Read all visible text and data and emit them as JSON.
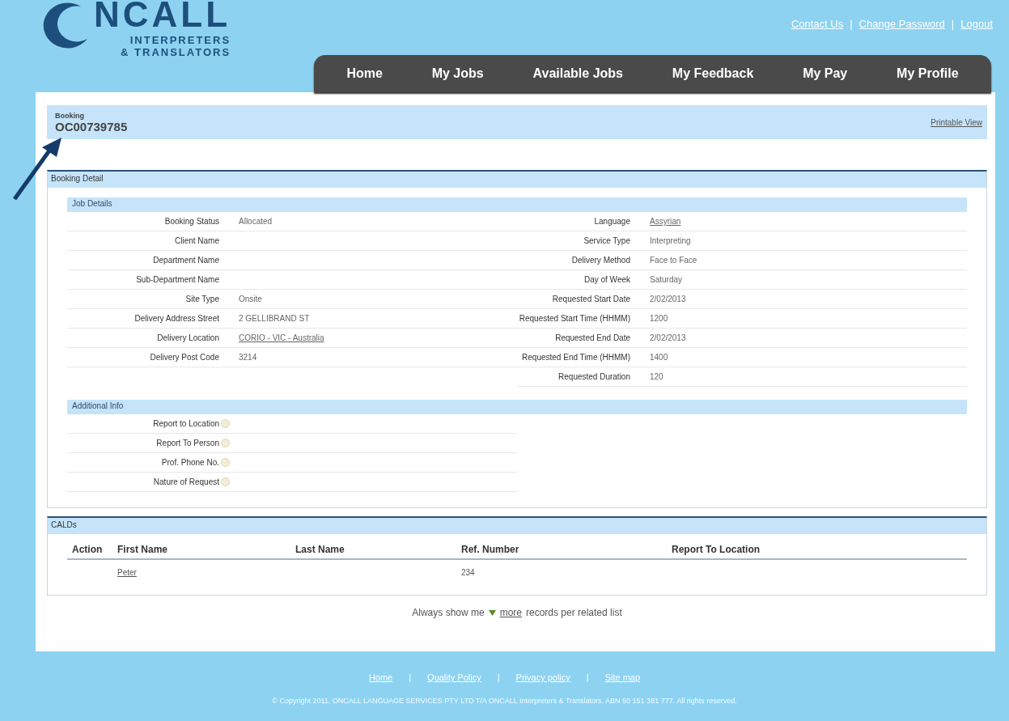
{
  "logo": {
    "name": "NCALL",
    "line_1": "INTERPRETERS",
    "line_2": "& TRANSLATORS"
  },
  "top_links": {
    "items": [
      "Contact Us",
      "Change Password",
      "Logout"
    ],
    "separators": [
      "|",
      "|"
    ]
  },
  "nav": {
    "items": [
      {
        "label": "Home",
        "selected": false
      },
      {
        "label": "My Jobs",
        "selected": false
      },
      {
        "label": "Available Jobs",
        "selected": false
      },
      {
        "label": "My Feedback",
        "selected": false
      },
      {
        "label": "My Pay",
        "selected": false
      },
      {
        "label": "My Profile",
        "selected": false
      }
    ]
  },
  "booking": {
    "label": "Booking",
    "number": "OC00739785",
    "printable_link": "Printable View"
  },
  "booking_detail": {
    "title": "Booking Detail",
    "job_details": {
      "title": "Job Details",
      "left": [
        {
          "label": "Booking Status",
          "value": "Allocated",
          "link": false
        },
        {
          "label": "Client Name"
        },
        {
          "label": "Department Name"
        },
        {
          "label": "Sub-Department Name"
        },
        {
          "label": "Site Type",
          "value": "Onsite",
          "link": false
        },
        {
          "label": "Delivery Address Street",
          "value": "2 GELLIBRAND ST",
          "link": false
        },
        {
          "label": "Delivery Location",
          "value": "CORIO - VIC - Australia",
          "link": true
        },
        {
          "label": "Delivery Post Code",
          "value": "3214",
          "link": false
        }
      ],
      "right": [
        {
          "label": "Language",
          "value": "Assyrian",
          "link": true
        },
        {
          "label": "Service Type",
          "value": "Interpreting",
          "link": false
        },
        {
          "label": "Delivery Method",
          "value": "Face to Face",
          "link": false
        },
        {
          "label": "Day of Week",
          "value": "Saturday",
          "link": false
        },
        {
          "label": "Requested Start Date",
          "value": "2/02/2013",
          "link": false
        },
        {
          "label": "Requested Start Time (HHMM)",
          "value": "1200",
          "link": false
        },
        {
          "label": "Requested End Date",
          "value": "2/02/2013",
          "link": false
        },
        {
          "label": "Requested End Time (HHMM)",
          "value": "1400",
          "link": false
        },
        {
          "label": "Requested Duration",
          "value": "120",
          "link": false
        }
      ]
    },
    "additional_info": {
      "title": "Additional Info",
      "rows": [
        {
          "label": "Report to Location"
        },
        {
          "label": "Report To Person"
        },
        {
          "label": "Prof. Phone No."
        },
        {
          "label": "Nature of Request"
        }
      ]
    }
  },
  "calds": {
    "title": "CALDs",
    "columns": [
      "Action",
      "First Name",
      "Last Name",
      "Ref. Number",
      "Report To Location"
    ],
    "rows": [
      {
        "cells": [
          null,
          {
            "text": "Peter",
            "link": true
          },
          null,
          {
            "text": "234",
            "link": false
          },
          null
        ]
      }
    ]
  },
  "records_note": {
    "before": "Always show me",
    "link": "more",
    "after": "records per related list"
  },
  "footer": {
    "links": [
      "Home",
      "Quality Policy",
      "Privacy policy",
      "Site map"
    ],
    "separators": [
      "|",
      "|",
      "|"
    ],
    "copyright": "© Copyright 2011. ONCALL LANGUAGE SERVICES PTY LTD T/A ONCALL Interpreters & Translators. ABN 50 151 381 777. All rights reserved."
  }
}
